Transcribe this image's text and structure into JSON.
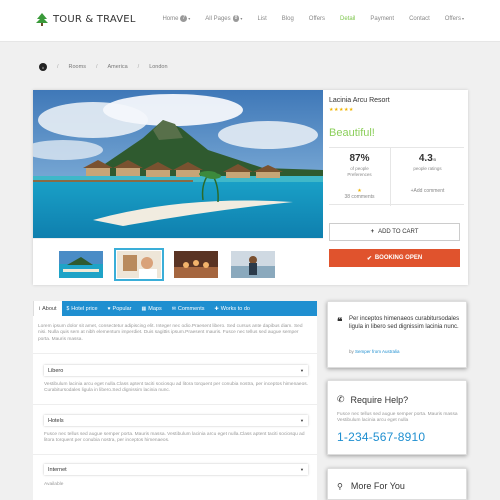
{
  "header": {
    "brand": "TOUR & TRAVEL",
    "nav": [
      {
        "label": "Home",
        "badge": "7",
        "caret": true,
        "active": false
      },
      {
        "label": "All Pages",
        "badge": "8",
        "caret": true,
        "active": false
      },
      {
        "label": "List",
        "badge": null,
        "caret": false,
        "active": false
      },
      {
        "label": "Blog",
        "badge": null,
        "caret": false,
        "active": false
      },
      {
        "label": "Offers",
        "badge": null,
        "caret": false,
        "active": false
      },
      {
        "label": "Detail",
        "badge": null,
        "caret": false,
        "active": true
      },
      {
        "label": "Payment",
        "badge": null,
        "caret": false,
        "active": false
      },
      {
        "label": "Contact",
        "badge": null,
        "caret": false,
        "active": false
      },
      {
        "label": "Offers",
        "badge": null,
        "caret": true,
        "active": false
      }
    ]
  },
  "breadcrumb": {
    "items": [
      "Rooms",
      "America",
      "London"
    ]
  },
  "hotel": {
    "name": "Lacinia Arcu Resort",
    "stars": "★★★★★",
    "rating_word": "Beautiful!",
    "percent": "87%",
    "percent_label": "of people Preferences",
    "score": "4.3",
    "score_suffix": "/5",
    "score_label": "people ratings",
    "comments_star": "★",
    "comments_label": "38 comments",
    "add_comment": "+Add comment",
    "cart_label": "ADD TO CART",
    "booking_label": "BOOKING OPEN"
  },
  "tabs": [
    {
      "icon": "i",
      "label": "About",
      "active": true
    },
    {
      "icon": "$",
      "label": "Hotel price",
      "active": false
    },
    {
      "icon": "♥",
      "label": "Popular",
      "active": false
    },
    {
      "icon": "▦",
      "label": "Maps",
      "active": false
    },
    {
      "icon": "✉",
      "label": "Comments",
      "active": false
    },
    {
      "icon": "✚",
      "label": "Works to do",
      "active": false
    }
  ],
  "about": {
    "text": "Lorem ipsum dolor sit amet, consectetur adipiscing elit. Integer nec odio.Praesent libero. Sed cursus ante dapibus diam. Sed nisi. Nulla quis sem at nibh elementum imperdiet. Duis sagittis ipsum.Praesent mauris. Fusce nec tellus sed augue semper porta. Mauris massa."
  },
  "sections": [
    {
      "select": "Libero",
      "text": "Vestibulum lacinia arcu eget nulla.Class aptent taciti sociosqu ad litora torquent per conubia nostra, per inceptos himenaeos. Curabitursodales ligula in libero.Sed dignissim lacinia nunc."
    },
    {
      "select": "Hotels",
      "text": "Fusce nec tellus sed augue semper porta. Mauris massa. Vestibulum lacinia arcu eget nulla.Class aptent taciti sociosqu ad litora torquent per conubia nostra, per inceptos himenaeos."
    },
    {
      "select": "Internet",
      "text": "Available"
    }
  ],
  "quote": {
    "mark": "❝",
    "text": "Per inceptos himenaeos curabitursodales ligula in libero sed dignissim lacinia nunc.",
    "by_prefix": "by",
    "by_name": "Semper from Australia"
  },
  "help": {
    "title": "Require Help?",
    "text": "Fusce nec tellus sed augue semper porta. Mauris massa Vestibulum lacinia arcu eget nulla",
    "phone": "1-234-567-8910"
  },
  "more": {
    "title": "More For You"
  },
  "colors": {
    "accent_blue": "#1f8fd0",
    "accent_green": "#8ccf5c",
    "booking_orange": "#e0532d",
    "star_gold": "#f0b400"
  }
}
